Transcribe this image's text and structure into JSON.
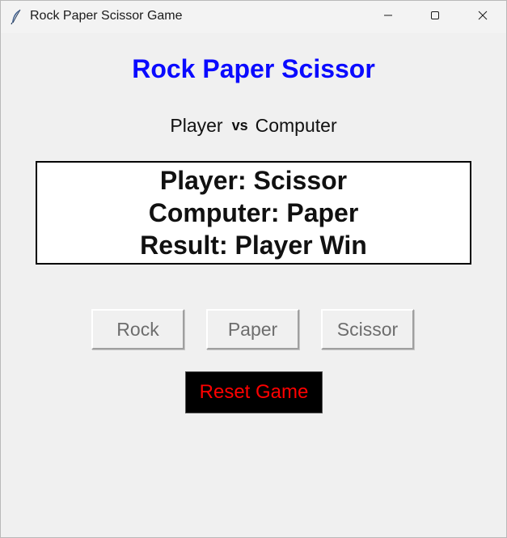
{
  "window": {
    "title": "Rock Paper Scissor Game",
    "app_icon": "feather-icon",
    "controls": [
      "minimize-icon",
      "maximize-icon",
      "close-icon"
    ]
  },
  "game": {
    "heading": "Rock Paper Scissor",
    "player_label": "Player",
    "vs_label": "vs",
    "computer_label": "Computer"
  },
  "result": {
    "player_line": "Player: Scissor",
    "computer_line": "Computer: Paper",
    "result_line": "Result: Player Win"
  },
  "buttons": {
    "rock": "Rock",
    "paper": "Paper",
    "scissor": "Scissor",
    "reset": "Reset Game"
  },
  "colors": {
    "heading": "#0a0aff",
    "reset_text": "#ff0000",
    "reset_bg": "#000000",
    "disabled_text": "#6d6d6d",
    "window_bg": "#f0f0f0"
  }
}
